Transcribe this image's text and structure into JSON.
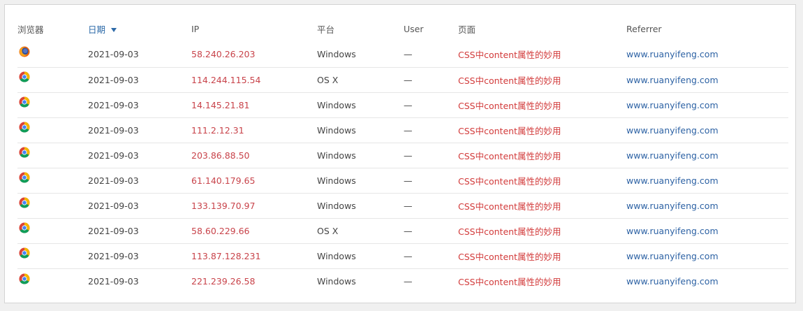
{
  "headers": {
    "browser": "浏览器",
    "date": "日期",
    "ip": "IP",
    "platform": "平台",
    "user": "User",
    "page": "页面",
    "referrer": "Referrer"
  },
  "rows": [
    {
      "browser_icon": "firefox-icon",
      "date": "2021-09-03",
      "ip": "58.240.26.203",
      "platform": "Windows",
      "user": "—",
      "page": "CSS中content属性的妙用",
      "referrer": "www.ruanyifeng.com"
    },
    {
      "browser_icon": "chrome-icon",
      "date": "2021-09-03",
      "ip": "114.244.115.54",
      "platform": "OS X",
      "user": "—",
      "page": "CSS中content属性的妙用",
      "referrer": "www.ruanyifeng.com"
    },
    {
      "browser_icon": "chrome-icon",
      "date": "2021-09-03",
      "ip": "14.145.21.81",
      "platform": "Windows",
      "user": "—",
      "page": "CSS中content属性的妙用",
      "referrer": "www.ruanyifeng.com"
    },
    {
      "browser_icon": "chrome-icon",
      "date": "2021-09-03",
      "ip": "111.2.12.31",
      "platform": "Windows",
      "user": "—",
      "page": "CSS中content属性的妙用",
      "referrer": "www.ruanyifeng.com"
    },
    {
      "browser_icon": "chrome-icon",
      "date": "2021-09-03",
      "ip": "203.86.88.50",
      "platform": "Windows",
      "user": "—",
      "page": "CSS中content属性的妙用",
      "referrer": "www.ruanyifeng.com"
    },
    {
      "browser_icon": "chrome-icon",
      "date": "2021-09-03",
      "ip": "61.140.179.65",
      "platform": "Windows",
      "user": "—",
      "page": "CSS中content属性的妙用",
      "referrer": "www.ruanyifeng.com"
    },
    {
      "browser_icon": "chrome-icon",
      "date": "2021-09-03",
      "ip": "133.139.70.97",
      "platform": "Windows",
      "user": "—",
      "page": "CSS中content属性的妙用",
      "referrer": "www.ruanyifeng.com"
    },
    {
      "browser_icon": "chrome-icon",
      "date": "2021-09-03",
      "ip": "58.60.229.66",
      "platform": "OS X",
      "user": "—",
      "page": "CSS中content属性的妙用",
      "referrer": "www.ruanyifeng.com"
    },
    {
      "browser_icon": "chrome-icon",
      "date": "2021-09-03",
      "ip": "113.87.128.231",
      "platform": "Windows",
      "user": "—",
      "page": "CSS中content属性的妙用",
      "referrer": "www.ruanyifeng.com"
    },
    {
      "browser_icon": "chrome-icon",
      "date": "2021-09-03",
      "ip": "221.239.26.58",
      "platform": "Windows",
      "user": "—",
      "page": "CSS中content属性的妙用",
      "referrer": "www.ruanyifeng.com"
    }
  ],
  "colors": {
    "sorted_header": "#2d6aa8",
    "ip": "#c8434a",
    "page_link": "#d23a3a",
    "referrer_link": "#2d62a4"
  }
}
